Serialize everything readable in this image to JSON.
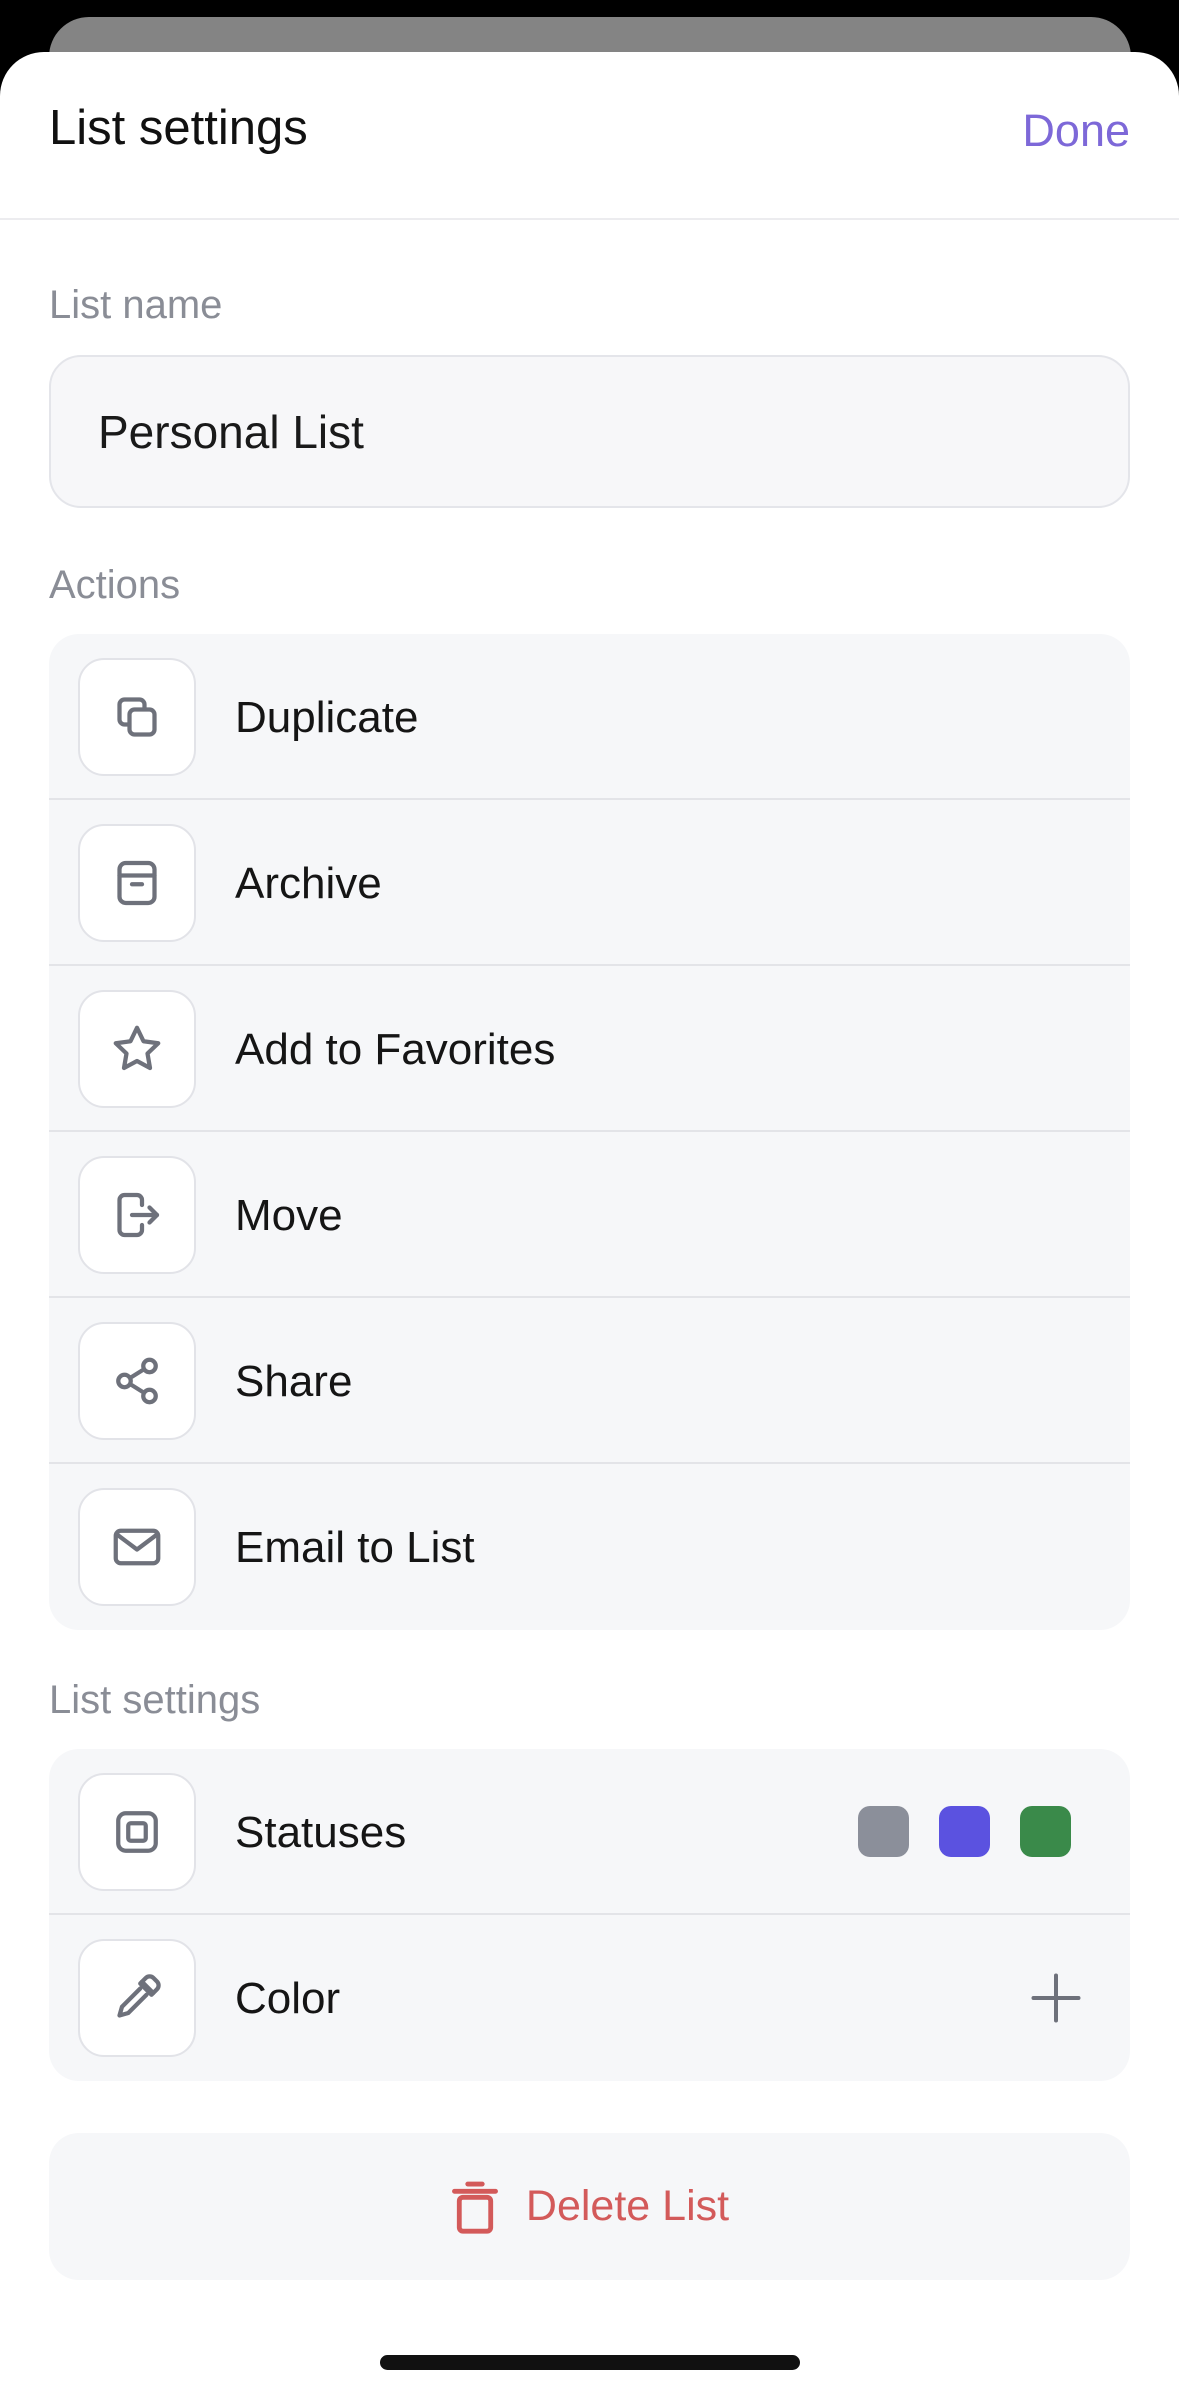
{
  "header": {
    "title": "List settings",
    "done_label": "Done"
  },
  "list_name": {
    "label": "List name",
    "value": "Personal List"
  },
  "actions": {
    "label": "Actions",
    "items": [
      {
        "label": "Duplicate",
        "icon": "duplicate-icon"
      },
      {
        "label": "Archive",
        "icon": "archive-icon"
      },
      {
        "label": "Add to Favorites",
        "icon": "star-icon"
      },
      {
        "label": "Move",
        "icon": "move-icon"
      },
      {
        "label": "Share",
        "icon": "share-icon"
      },
      {
        "label": "Email to List",
        "icon": "email-icon"
      }
    ]
  },
  "list_settings": {
    "label": "List settings",
    "statuses": {
      "label": "Statuses",
      "icon": "statuses-icon",
      "colors": [
        "#8b8f9a",
        "#5b52e0",
        "#3a8a4a"
      ]
    },
    "color": {
      "label": "Color",
      "icon": "eyedropper-icon",
      "action_icon": "plus-icon"
    }
  },
  "delete": {
    "label": "Delete List",
    "icon": "trash-icon",
    "color": "#d35a5a"
  },
  "colors": {
    "accent": "#7d68d8",
    "icon": "#6e717b"
  }
}
